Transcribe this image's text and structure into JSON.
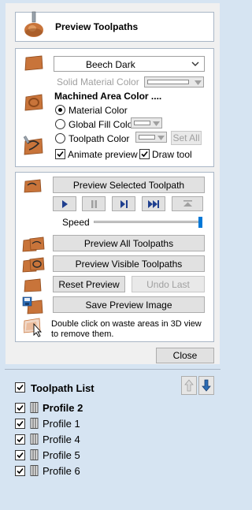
{
  "header": {
    "title": "Preview Toolpaths"
  },
  "material": {
    "selected": "Beech Dark",
    "solid_color_label": "Solid Material Color",
    "machined_title": "Machined Area Color ....",
    "radio_material": "Material Color",
    "radio_global": "Global Fill Color",
    "radio_toolpath": "Toolpath Color",
    "set_all": "Set All",
    "animate_label": "Animate preview",
    "draw_tool_label": "Draw tool"
  },
  "preview": {
    "selected_button": "Preview Selected Toolpath",
    "speed_label": "Speed",
    "speed_value": 1.0,
    "all_button": "Preview All Toolpaths",
    "visible_button": "Preview Visible Toolpaths",
    "reset_button": "Reset Preview",
    "undo_button": "Undo Last",
    "save_button": "Save Preview Image",
    "hint_line1": "Double click on waste areas in 3D view",
    "hint_line2": "to remove them."
  },
  "close_button": "Close",
  "toolpath_list": {
    "title": "Toolpath List",
    "items": [
      {
        "label": "Profile 2",
        "checked": true,
        "bold": true
      },
      {
        "label": "Profile 1",
        "checked": true,
        "bold": false
      },
      {
        "label": "Profile 4",
        "checked": true,
        "bold": false
      },
      {
        "label": "Profile 5",
        "checked": true,
        "bold": false
      },
      {
        "label": "Profile 6",
        "checked": true,
        "bold": false
      }
    ]
  },
  "colors": {
    "wood": "#c8743a",
    "wood_dark": "#8e4a1c",
    "accent_blue": "#1f5fbf",
    "panel_bg": "#f0f0f0",
    "outer_bg": "#d6e4f2"
  }
}
